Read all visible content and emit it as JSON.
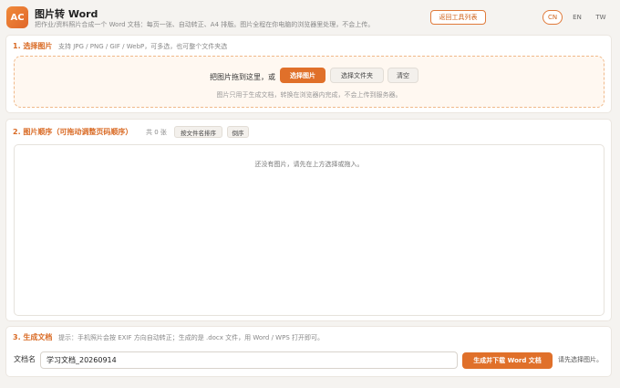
{
  "header": {
    "logo_text": "AC",
    "title": "图片转 Word",
    "subtitle": "把作业/资料照片合成一个 Word 文档：每页一张、自动转正、A4 排版。图片全程在你电脑的浏览器里处理，不会上传。",
    "back_button": "返回工具列表",
    "languages": [
      "CN",
      "EN",
      "TW"
    ],
    "active_language": "CN"
  },
  "section1": {
    "title": "1. 选择图片",
    "hint": "支持 JPG / PNG / GIF / WebP，可多选，也可整个文件夹选",
    "drop_text": "把图片拖到这里，或",
    "choose_images": "选择图片",
    "choose_folder": "选择文件夹",
    "clear": "清空",
    "note": "图片只用于生成文档，转换在浏览器内完成，不会上传到服务器。"
  },
  "section2": {
    "title": "2. 图片顺序（可拖动调整页码顺序）",
    "count_text": "共 0 张",
    "sort_by_name": "按文件名排序",
    "reverse": "倒序",
    "empty_text": "还没有图片，请先在上方选择或拖入。"
  },
  "section3": {
    "title": "3. 生成文档",
    "hint": "提示：手机照片会按 EXIF 方向自动转正；生成的是 .docx 文件，用 Word / WPS 打开即可。",
    "filename_label": "文档名",
    "filename_value": "学习文档_20260914",
    "generate_button": "生成并下载 Word 文档",
    "status": "请先选择图片。"
  },
  "colors": {
    "accent": "#e0702a",
    "accent_text": "#d96a24",
    "background": "#f5f3f0"
  }
}
